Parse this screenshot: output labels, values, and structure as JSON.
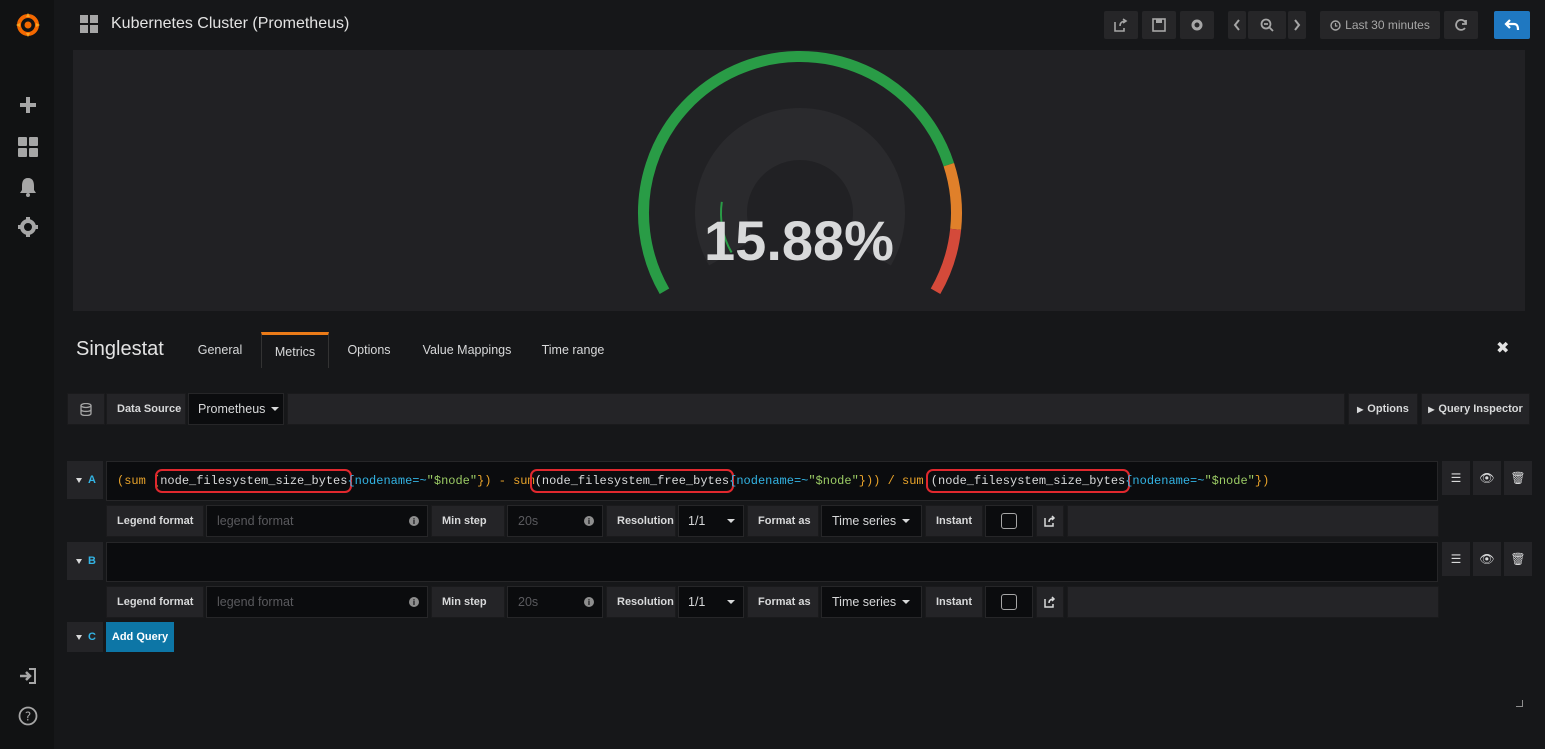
{
  "header": {
    "title": "Kubernetes Cluster (Prometheus)",
    "time_range": "Last 30 minutes"
  },
  "gauge": {
    "value": 15.88,
    "display": "15.88%",
    "colors": {
      "green": "#299c46",
      "orange": "#e0802a",
      "red": "#d44a3a",
      "track": "#2a2a2d"
    }
  },
  "editor": {
    "panel_type": "Singlestat",
    "tabs": [
      "General",
      "Metrics",
      "Options",
      "Value Mappings",
      "Time range"
    ],
    "active_tab": "Metrics",
    "datasource_label": "Data Source",
    "datasource_value": "Prometheus",
    "options_btn": "Options",
    "query_inspector_btn": "Query Inspector",
    "add_query": "Add Query"
  },
  "queries": [
    {
      "ref": "A",
      "expr_parts": {
        "p1": "(sum (",
        "m1": "node_filesystem_size_bytes",
        "l1": "{nodename=~",
        "s1": "\"$node\"",
        "c1": "}) - sum",
        "m2": "(node_filesystem_free_bytes",
        "l2": "{nodename=~",
        "s2": "\"$node\"",
        "c2": "})) / sum ",
        "m3": "(node_filesystem_size_bytes",
        "l3": "{nodename=~",
        "s3": "\"$node\"",
        "c3": "})"
      },
      "legend_format_label": "Legend format",
      "legend_format_placeholder": "legend format",
      "min_step_label": "Min step",
      "min_step_placeholder": "20s",
      "resolution_label": "Resolution",
      "resolution_value": "1/1",
      "format_as_label": "Format as",
      "format_as_value": "Time series",
      "instant_label": "Instant"
    },
    {
      "ref": "B",
      "legend_format_label": "Legend format",
      "legend_format_placeholder": "legend format",
      "min_step_label": "Min step",
      "min_step_placeholder": "20s",
      "resolution_label": "Resolution",
      "resolution_value": "1/1",
      "format_as_label": "Format as",
      "format_as_value": "Time series",
      "instant_label": "Instant"
    },
    {
      "ref": "C"
    }
  ],
  "icons": {
    "logo": "grafana-logo",
    "sidebar": [
      "plus-icon",
      "dashboards-icon",
      "bell-icon",
      "gear-icon",
      "sign-in-icon",
      "help-icon"
    ]
  }
}
